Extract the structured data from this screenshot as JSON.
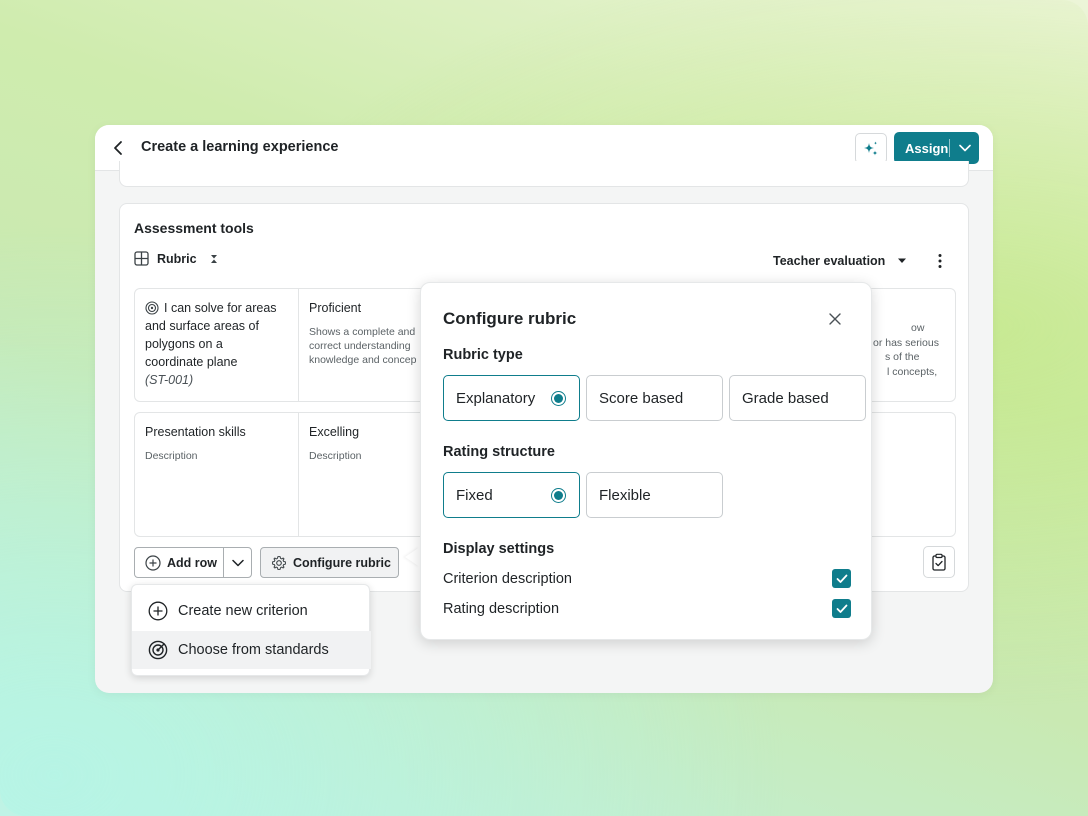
{
  "header": {
    "title": "Create a learning experience",
    "assign_label": "Assign"
  },
  "assessment": {
    "title": "Assessment tools",
    "tool_label": "Rubric",
    "evaluation_select": "Teacher evaluation",
    "rows": [
      {
        "criterion": "I can solve for areas and surfaces areas of polygons on a coordinate plane",
        "criterion_lines": [
          "I can solve for areas",
          "and surface areas of",
          "polygons on a",
          "coordinate plane"
        ],
        "code": "(ST-001)",
        "level": "Proficient",
        "level_desc_lines": [
          "Shows a complete and",
          "correct understanding",
          "knowledge and concep"
        ],
        "right_desc_lines": [
          "ow",
          "or has serious",
          "s of the",
          "l concepts,"
        ]
      },
      {
        "criterion": "Presentation skills",
        "criterion_desc": "Description",
        "level": "Excelling",
        "level_desc": "Description"
      }
    ],
    "add_row_label": "Add row",
    "configure_label": "Configure rubric"
  },
  "add_row_menu": {
    "items": [
      {
        "label": "Create new criterion"
      },
      {
        "label": "Choose from standards"
      }
    ]
  },
  "configure_modal": {
    "title": "Configure rubric",
    "rubric_type_label": "Rubric type",
    "rubric_types": [
      "Explanatory",
      "Score based",
      "Grade based"
    ],
    "rubric_type_selected": "Explanatory",
    "rating_structure_label": "Rating structure",
    "rating_structures": [
      "Fixed",
      "Flexible"
    ],
    "rating_structure_selected": "Fixed",
    "display_settings_label": "Display settings",
    "display_settings": [
      {
        "label": "Criterion description",
        "checked": true
      },
      {
        "label": "Rating description",
        "checked": true
      }
    ]
  },
  "colors": {
    "accent": "#0f7d8c",
    "border": "#e3e5e6"
  }
}
